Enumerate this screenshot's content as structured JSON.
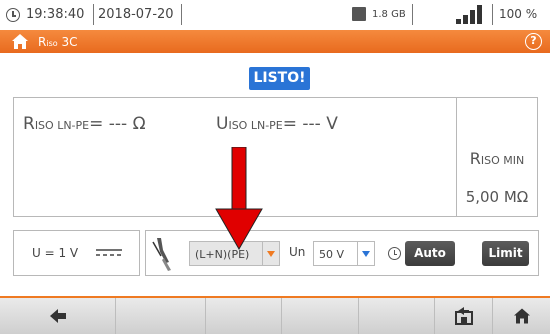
{
  "status_bar": {
    "time": "19:38:40",
    "date": "2018-07-20",
    "storage": "1.8 GB",
    "battery_percent": "100 %",
    "icons": [
      "clock-icon",
      "storage-icon",
      "signal-icon",
      "battery-icon",
      "plug-icon"
    ]
  },
  "title_bar": {
    "title_main": "R",
    "title_sub": "iso",
    "title_suffix": " 3C",
    "accent_color": "#ef7a22"
  },
  "ready_badge": "LISTO!",
  "results": {
    "r_main": "R",
    "r_sub": "ISO LN-PE",
    "r_value": "= --- Ω",
    "u_main": "U",
    "u_sub": "ISO LN-PE",
    "u_value": "= --- V",
    "rmin_main": "R",
    "rmin_sub": "ISO MIN",
    "rmin_value": "5,00 MΩ"
  },
  "voltage": {
    "u_text": "U = 1 V"
  },
  "settings": {
    "circuit_value": "(L+N)(PE)",
    "un_label": "Un",
    "un_value": "50 V",
    "auto_label": "Auto",
    "limit_label": "Limit"
  },
  "toolbar": {
    "buttons": [
      "back-arrow-icon",
      "",
      "",
      "",
      "",
      "save-to-memory-icon",
      "home-icon"
    ]
  },
  "colors": {
    "accent": "#ef7a22",
    "ready_blue": "#2a74d6",
    "arrow_red": "#e00000"
  }
}
